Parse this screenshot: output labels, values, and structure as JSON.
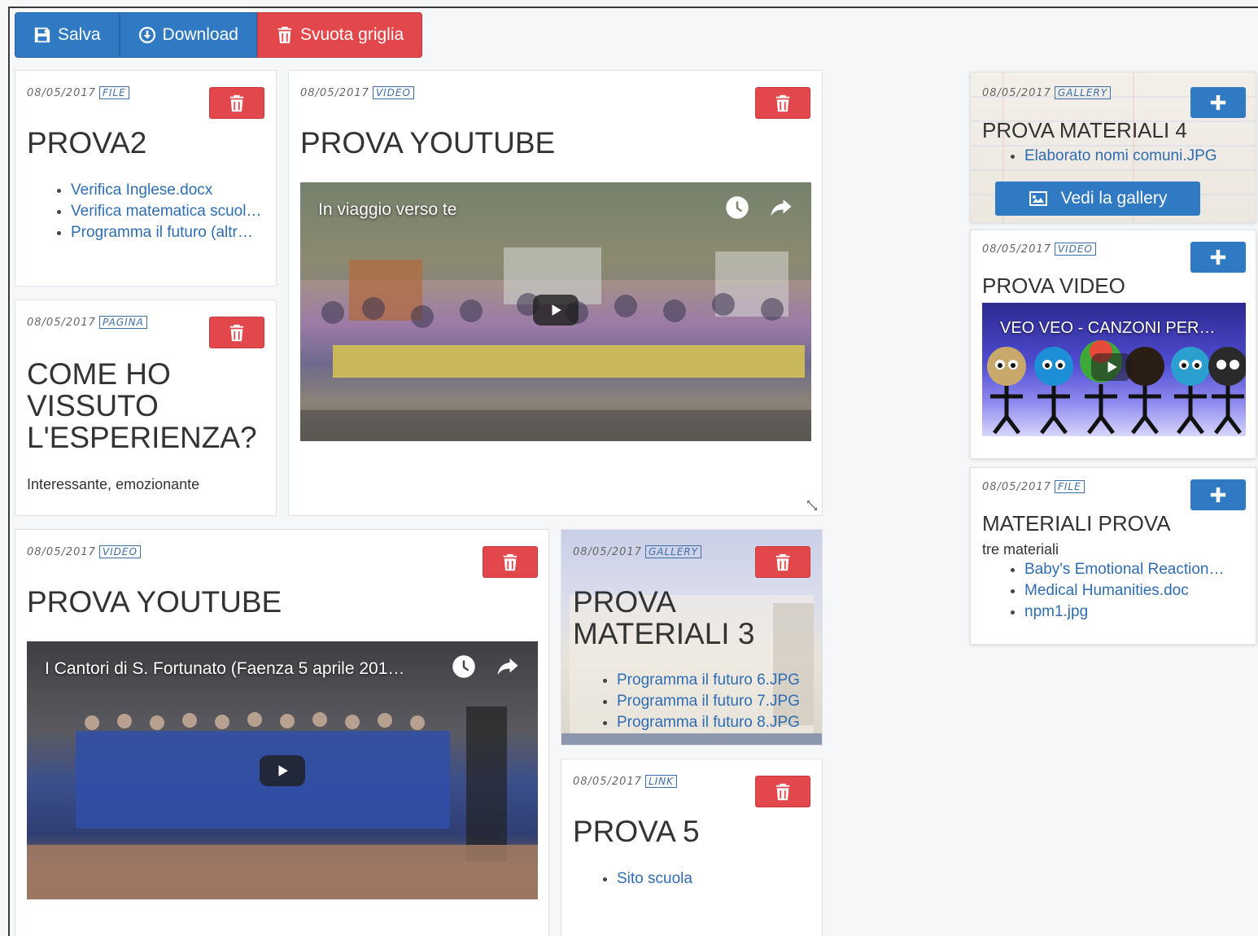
{
  "toolbar": {
    "save_label": "Salva",
    "download_label": "Download",
    "clear_label": "Svuota griglia"
  },
  "cards": {
    "prova2": {
      "date": "08/05/2017",
      "type": "FILE",
      "title": "PROVA2",
      "files": [
        "Verifica Inglese.docx",
        "Verifica matematica scuol…",
        "Programma il futuro (altr…"
      ]
    },
    "come_ho": {
      "date": "08/05/2017",
      "type": "PAGINA",
      "title_line1": "COME HO",
      "title_line2": "VISSUTO",
      "title_line3": "L'ESPERIENZA?",
      "text": "Interessante, emozionante"
    },
    "yt1": {
      "date": "08/05/2017",
      "type": "VIDEO",
      "title": "PROVA YOUTUBE",
      "video_title": "In viaggio verso te"
    },
    "yt2": {
      "date": "08/05/2017",
      "type": "VIDEO",
      "title": "PROVA YOUTUBE",
      "video_title": "I Cantori di S. Fortunato (Faenza 5 aprile 201…"
    },
    "mat3": {
      "date": "08/05/2017",
      "type": "GALLERY",
      "title_line1": "PROVA",
      "title_line2": "MATERIALI 3",
      "files": [
        "Programma il futuro 6.JPG",
        "Programma il futuro 7.JPG",
        "Programma il futuro 8.JPG"
      ]
    },
    "prova5": {
      "date": "08/05/2017",
      "type": "LINK",
      "title": "PROVA 5",
      "links": [
        "Sito scuola"
      ]
    },
    "mat4": {
      "date": "08/05/2017",
      "type": "GALLERY",
      "title": "PROVA MATERIALI 4",
      "files": [
        "Elaborato nomi comuni.JPG"
      ],
      "gallery_label": "Vedi la gallery"
    },
    "provavideo": {
      "date": "08/05/2017",
      "type": "VIDEO",
      "title": "PROVA VIDEO",
      "video_title": "VEO VEO - CANZONI PER…"
    },
    "matprova": {
      "date": "08/05/2017",
      "type": "FILE",
      "title": "MATERIALI PROVA",
      "text": "tre materiali",
      "files": [
        "Baby's Emotional Reaction…",
        "Medical Humanities.doc",
        "npm1.jpg"
      ]
    }
  }
}
